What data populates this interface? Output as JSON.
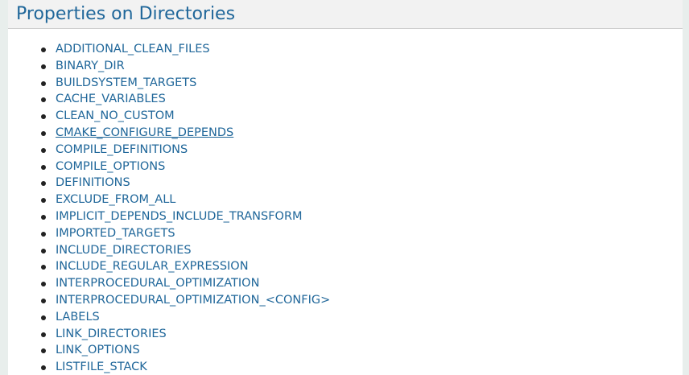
{
  "section": {
    "title": "Properties on Directories"
  },
  "properties": [
    {
      "label": "ADDITIONAL_CLEAN_FILES"
    },
    {
      "label": "BINARY_DIR"
    },
    {
      "label": "BUILDSYSTEM_TARGETS"
    },
    {
      "label": "CACHE_VARIABLES"
    },
    {
      "label": "CLEAN_NO_CUSTOM"
    },
    {
      "label": "CMAKE_CONFIGURE_DEPENDS",
      "hovered": true
    },
    {
      "label": "COMPILE_DEFINITIONS"
    },
    {
      "label": "COMPILE_OPTIONS"
    },
    {
      "label": "DEFINITIONS"
    },
    {
      "label": "EXCLUDE_FROM_ALL"
    },
    {
      "label": "IMPLICIT_DEPENDS_INCLUDE_TRANSFORM"
    },
    {
      "label": "IMPORTED_TARGETS"
    },
    {
      "label": "INCLUDE_DIRECTORIES"
    },
    {
      "label": "INCLUDE_REGULAR_EXPRESSION"
    },
    {
      "label": "INTERPROCEDURAL_OPTIMIZATION"
    },
    {
      "label": "INTERPROCEDURAL_OPTIMIZATION_<CONFIG>"
    },
    {
      "label": "LABELS"
    },
    {
      "label": "LINK_DIRECTORIES"
    },
    {
      "label": "LINK_OPTIONS"
    },
    {
      "label": "LISTFILE_STACK"
    }
  ],
  "colors": {
    "link": "#20679a",
    "header_bg": "#f2f2f2",
    "page_bg": "#e8eeec"
  }
}
